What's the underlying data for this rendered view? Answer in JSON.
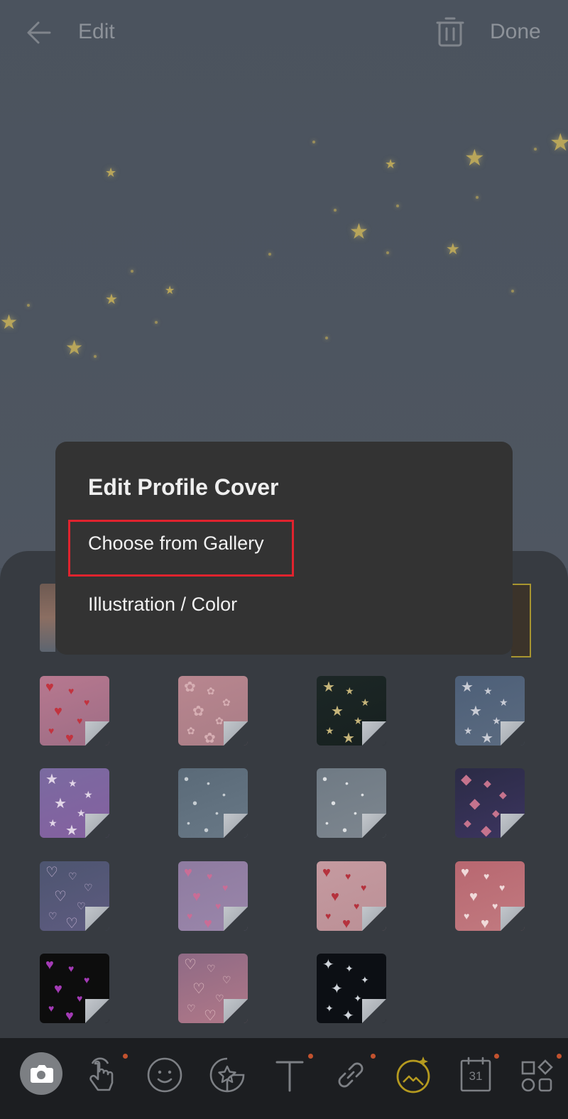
{
  "header": {
    "title": "Edit",
    "done_label": "Done",
    "back_icon": "back-arrow-icon",
    "delete_icon": "trash-icon"
  },
  "dialog": {
    "title": "Edit Profile Cover",
    "options": [
      {
        "label": "Choose from Gallery",
        "highlighted": true
      },
      {
        "label": "Illustration / Color"
      }
    ],
    "highlight_color": "#e0232e"
  },
  "covers": [
    {
      "name": "pink-hearts",
      "bg": "linear-gradient(160deg,#b7788f,#9d6d85)",
      "sym": "♥",
      "color": "#c2333f"
    },
    {
      "name": "pink-flowers",
      "bg": "linear-gradient(160deg,#b8868f,#a97d86)",
      "sym": "✿",
      "color": "#d6aeb3"
    },
    {
      "name": "gold-stars-dark",
      "bg": "linear-gradient(160deg,#1c2726,#17201f)",
      "sym": "★",
      "color": "#c6b57a"
    },
    {
      "name": "blue-stars",
      "bg": "linear-gradient(160deg,#4d5f78,#5b6b80)",
      "sym": "★",
      "color": "#c9ccd5"
    },
    {
      "name": "purple-sparkle",
      "bg": "linear-gradient(160deg,#7a6aa0,#8560a0)",
      "sym": "★",
      "color": "#e2d6e8"
    },
    {
      "name": "blue-snow",
      "bg": "linear-gradient(160deg,#5a6a78,#687886)",
      "sym": "•",
      "color": "#c6cdd2"
    },
    {
      "name": "grey-snow",
      "bg": "linear-gradient(160deg,#6f7a84,#7d868f)",
      "sym": "•",
      "color": "#dde0e3"
    },
    {
      "name": "confetti-night",
      "bg": "linear-gradient(160deg,#2b2b45,#3c3560)",
      "sym": "◆",
      "color": "#c5738d"
    },
    {
      "name": "outline-hearts",
      "bg": "linear-gradient(160deg,#4d5570,#5e5b80)",
      "sym": "♡",
      "color": "#c7b4d4"
    },
    {
      "name": "lavender-hearts",
      "bg": "linear-gradient(160deg,#8e7ba0,#9a86aa)",
      "sym": "♥",
      "color": "#c96d96"
    },
    {
      "name": "light-pink-hearts",
      "bg": "linear-gradient(160deg,#c59aa0,#bb9096)",
      "sym": "♥",
      "color": "#b5323d"
    },
    {
      "name": "red-glow-hearts",
      "bg": "linear-gradient(160deg,#b86770,#c17a80)",
      "sym": "♥",
      "color": "#f0dada"
    },
    {
      "name": "pixel-hearts-black",
      "bg": "#0d0d0d",
      "sym": "♥",
      "color": "#a33ab5"
    },
    {
      "name": "peach-hearts",
      "bg": "linear-gradient(160deg,#8f6a85,#b07888)",
      "sym": "♡",
      "color": "#e6c2c6"
    },
    {
      "name": "starfield-black",
      "bg": "#0c0f14",
      "sym": "✦",
      "color": "#cfd4da"
    }
  ],
  "toolbar": {
    "items": [
      {
        "name": "camera-icon"
      },
      {
        "name": "touch-icon"
      },
      {
        "name": "emoji-icon"
      },
      {
        "name": "sticker-icon"
      },
      {
        "name": "text-icon"
      },
      {
        "name": "link-icon"
      },
      {
        "name": "cover-image-icon",
        "active": true
      },
      {
        "name": "calendar-icon",
        "text": "31"
      },
      {
        "name": "grid-icon"
      }
    ],
    "active_color": "#b59a1f",
    "icon_color": "#7d8085"
  }
}
